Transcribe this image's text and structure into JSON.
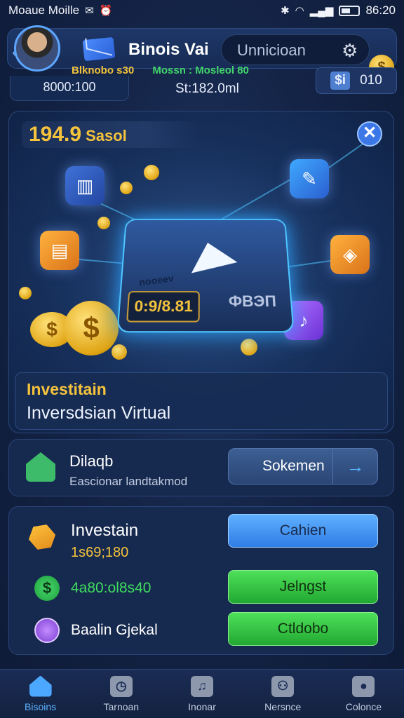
{
  "status_bar": {
    "app_name": "Moaue Moille",
    "time": "86:20"
  },
  "header": {
    "title": "Binois Vai",
    "search_text": "Unnicioan",
    "coin_symbol": "$",
    "stat_a": "Blknobo s30",
    "stat_b": "Mossn : Mosleol 80",
    "balance": "8000:100",
    "stat_mid": "St:182.0ml",
    "mini_button": {
      "icon": "$i",
      "value": "010"
    }
  },
  "hero": {
    "amount": "194.9",
    "amount_unit": "Sasol",
    "device_label": "nooeev",
    "device_screen": "0:9/8.81",
    "device_side": "ФВЭП",
    "coin_symbol": "$",
    "info_title": "Investitain",
    "info_subtitle": "Inversdsian Virtual"
  },
  "card_1": {
    "title": "Dilaqb",
    "subtitle": "Eascionar landtakmod",
    "button_label": "Sokemen"
  },
  "card_2": {
    "title": "Investain",
    "value": "1s69;180",
    "green_value": "4a80:ol8s40",
    "label": "Baalin Gjekal",
    "dollar_symbol": "$",
    "btn_blue": "Cahien",
    "btn_green_1": "Jelngst",
    "btn_green_2": "Ctldobo"
  },
  "bottom_nav": [
    {
      "label": "Bisoins",
      "icon": "home-icon",
      "active": true
    },
    {
      "label": "Tarnoan",
      "icon": "clock-icon",
      "active": false
    },
    {
      "label": "Inonar",
      "icon": "chart-icon",
      "active": false
    },
    {
      "label": "Nersnce",
      "icon": "people-icon",
      "active": false
    },
    {
      "label": "Colonce",
      "icon": "person-icon",
      "active": false
    }
  ],
  "colors": {
    "accent_blue": "#4ca8ff",
    "gold": "#f5c33c",
    "green": "#3fde5e",
    "background": "#142447"
  }
}
